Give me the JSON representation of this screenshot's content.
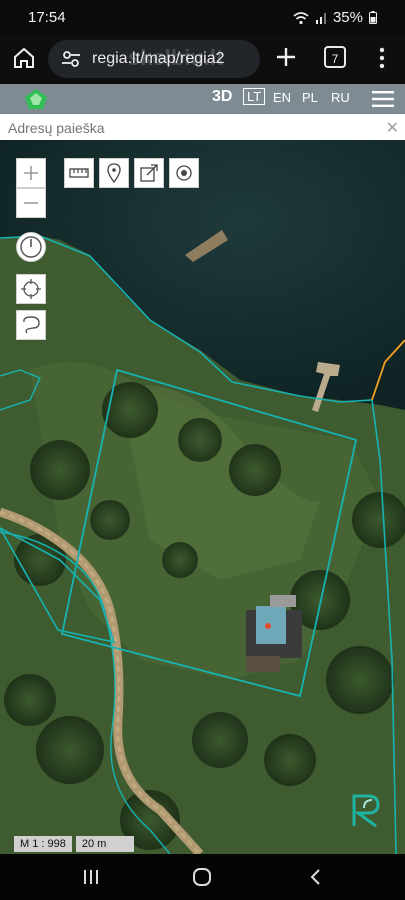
{
  "status_bar": {
    "time": "17:54",
    "battery": "35%"
  },
  "browser": {
    "url": "regia.lt/map/regia2",
    "url_overlay": "skelbiu.lt",
    "tab_count": "7"
  },
  "app": {
    "mode_3d": "3D",
    "languages": [
      "LT",
      "EN",
      "PL",
      "RU"
    ],
    "active_language": "LT"
  },
  "search": {
    "placeholder": "Adresų paieška"
  },
  "map": {
    "scale_label": "M 1 : 998",
    "distance_label": "20 m",
    "colors": {
      "parcel": "#16b3b3",
      "boundary": "#f0a020"
    }
  }
}
